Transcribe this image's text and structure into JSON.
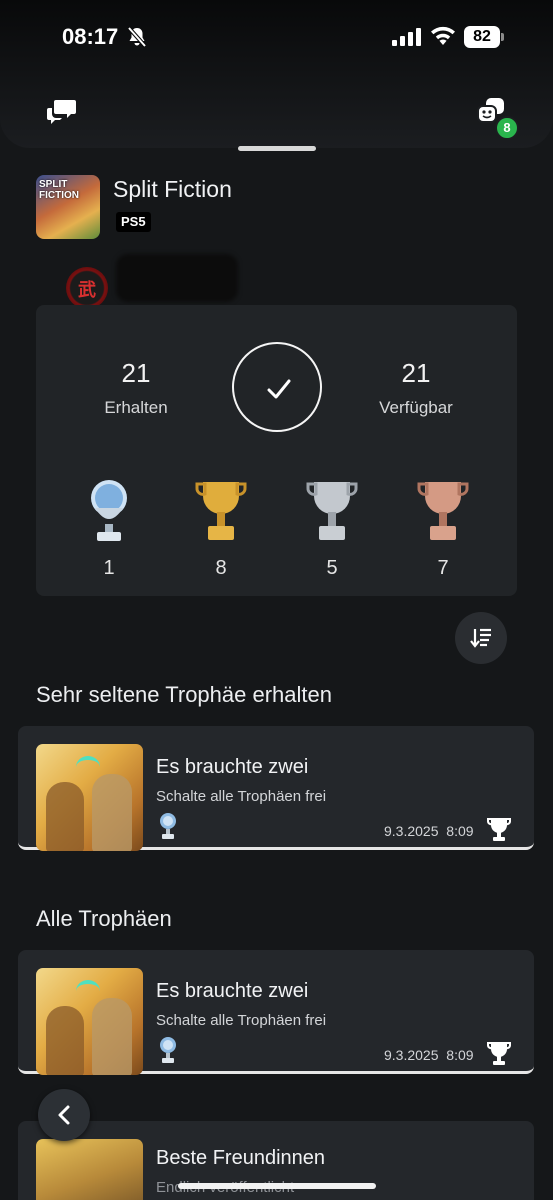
{
  "status_bar": {
    "time": "08:17",
    "battery": "82"
  },
  "header": {
    "party_badge_count": "8"
  },
  "game": {
    "title": "Split Fiction",
    "platform": "PS5",
    "cover_text": "SPLIT FICTION"
  },
  "summary": {
    "earned_count": "21",
    "earned_label": "Erhalten",
    "available_count": "21",
    "available_label": "Verfügbar",
    "trophies": [
      {
        "type": "platinum",
        "count": "1",
        "color": "#b9d3ea"
      },
      {
        "type": "gold",
        "count": "8",
        "color": "#d9a534"
      },
      {
        "type": "silver",
        "count": "5",
        "color": "#b7bcc2"
      },
      {
        "type": "bronze",
        "count": "7",
        "color": "#c98770"
      }
    ]
  },
  "sections": {
    "rare_title": "Sehr seltene Trophäe erhalten",
    "all_title": "Alle Trophäen"
  },
  "rare_trophy": {
    "name": "Es brauchte zwei",
    "description": "Schalte alle Trophäen frei",
    "date": "9.3.2025",
    "time": "8:09",
    "type_icon": "platinum-trophy-icon"
  },
  "all_trophies": [
    {
      "name": "Es brauchte zwei",
      "description": "Schalte alle Trophäen frei",
      "date": "9.3.2025",
      "time": "8:09",
      "type_icon": "platinum-trophy-icon"
    },
    {
      "name": "Beste Freundinnen",
      "description": "Endlich veröffentlicht"
    }
  ],
  "colors": {
    "background": "#151719",
    "card": "#24272b",
    "accent_green": "#2ab54d"
  }
}
